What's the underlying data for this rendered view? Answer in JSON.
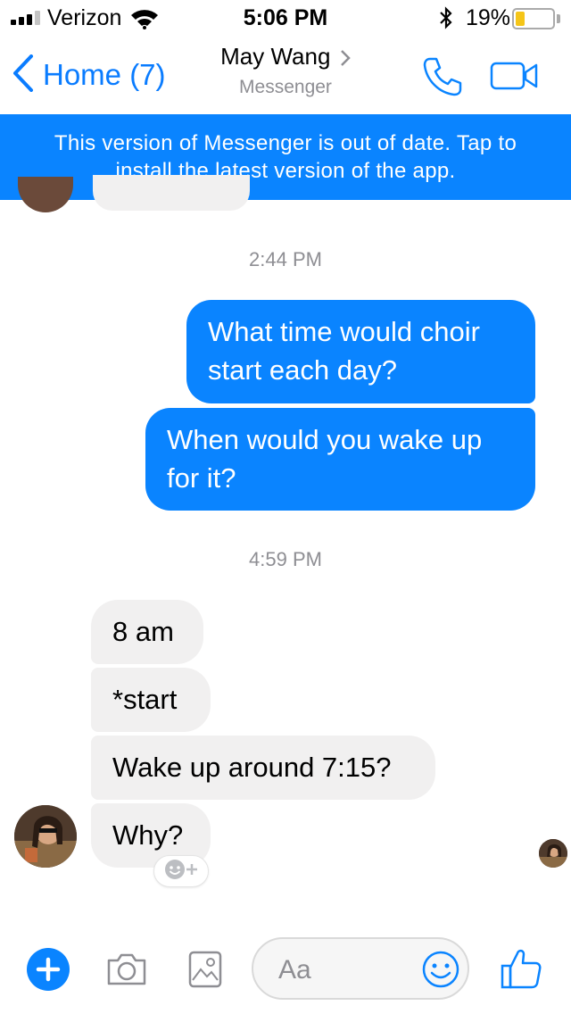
{
  "status_bar": {
    "carrier": "Verizon",
    "time": "5:06 PM",
    "battery_percent": "19%",
    "battery_level": 0.19,
    "signal_bars": 3,
    "signal_bars_total": 4
  },
  "header": {
    "back_label": "Home (7)",
    "contact_name": "May Wang",
    "contact_subtitle": "Messenger"
  },
  "banner": {
    "line1": "This version of Messenger is out of date. Tap to",
    "line2": "install the latest version of the app."
  },
  "conversation": {
    "timestamp_1": "2:44 PM",
    "sent": [
      {
        "line1": "What time would choir",
        "line2": "start each day?"
      },
      {
        "line1": "When would you wake up",
        "line2": "for it?"
      }
    ],
    "timestamp_2": "4:59 PM",
    "received": [
      {
        "text": "8 am"
      },
      {
        "text": "*start"
      },
      {
        "text": "Wake up around 7:15?"
      },
      {
        "text": "Why?"
      }
    ]
  },
  "composer": {
    "placeholder": "Aa"
  },
  "colors": {
    "accent": "#0a84ff",
    "incoming_bubble": "#f1f0f0",
    "muted_text": "#8e8e93",
    "battery_fill": "#f5c518"
  },
  "icons": {
    "back": "chevron-left-icon",
    "call": "phone-icon",
    "video": "video-camera-icon",
    "plus": "plus-icon",
    "camera": "camera-icon",
    "gallery": "image-icon",
    "emoji": "emoji-icon",
    "like": "thumbs-up-icon",
    "reaction": "add-reaction-icon"
  }
}
